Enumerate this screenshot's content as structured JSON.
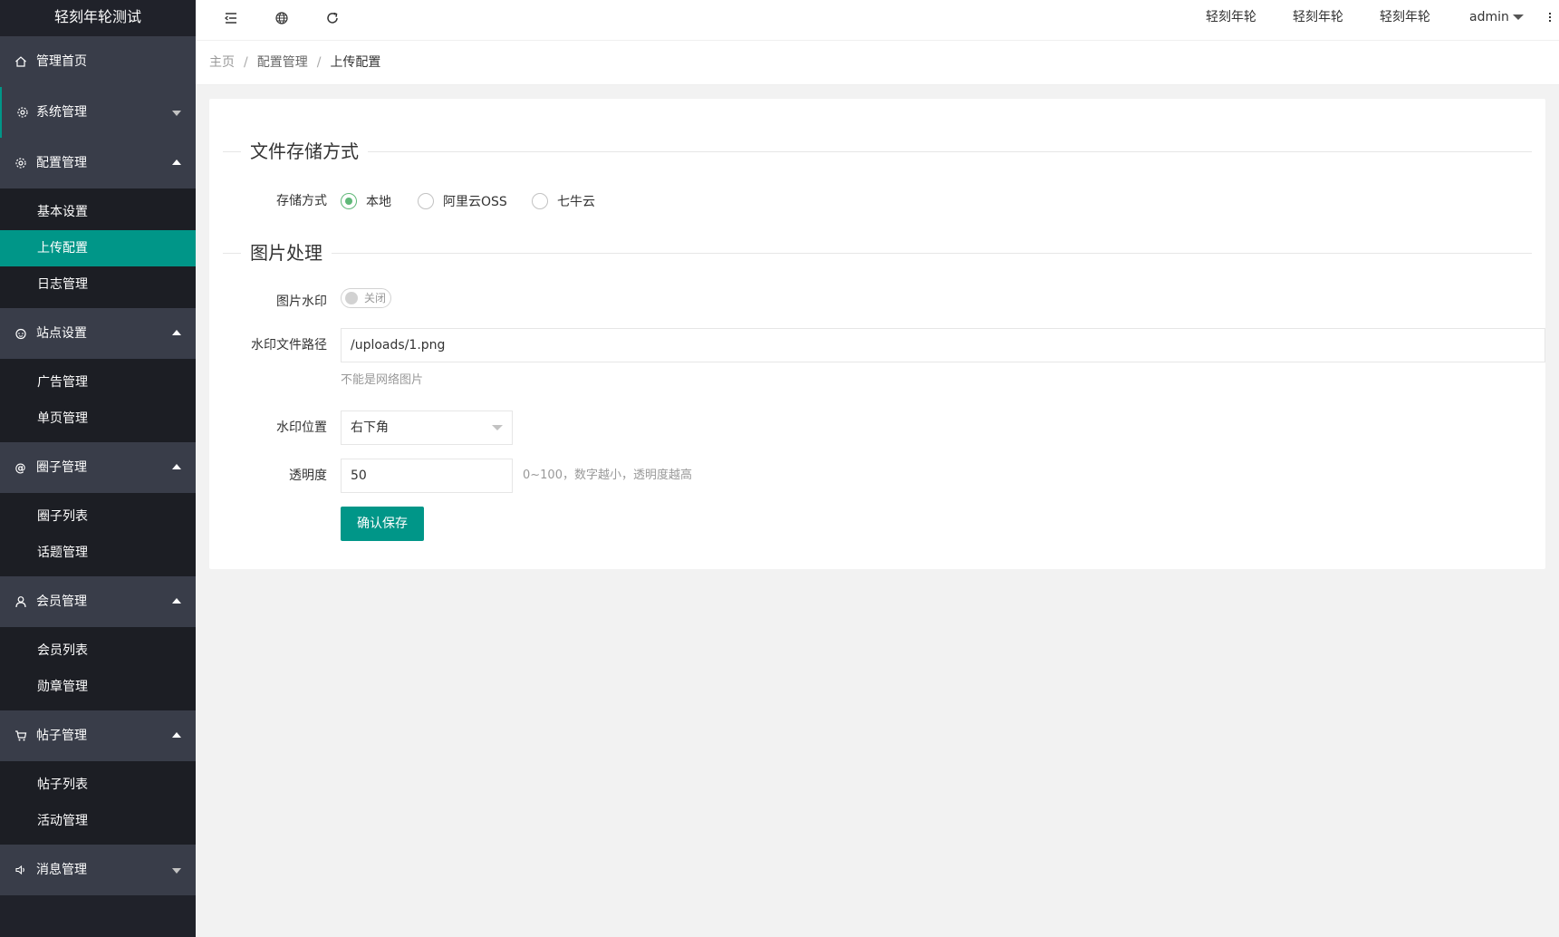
{
  "app": {
    "title": "轻刻年轮测试"
  },
  "sidebar": {
    "items": [
      {
        "label": "管理首页",
        "icon": "home-icon"
      },
      {
        "label": "系统管理",
        "icon": "gear-icon"
      },
      {
        "label": "配置管理",
        "icon": "gear-icon",
        "children": [
          "基本设置",
          "上传配置",
          "日志管理"
        ]
      },
      {
        "label": "站点设置",
        "icon": "face-icon",
        "children": [
          "广告管理",
          "单页管理"
        ]
      },
      {
        "label": "圈子管理",
        "icon": "at-icon",
        "children": [
          "圈子列表",
          "话题管理"
        ]
      },
      {
        "label": "会员管理",
        "icon": "user-icon",
        "children": [
          "会员列表",
          "勋章管理"
        ]
      },
      {
        "label": "帖子管理",
        "icon": "cart-icon",
        "children": [
          "帖子列表",
          "活动管理"
        ]
      },
      {
        "label": "消息管理",
        "icon": "speaker-icon"
      }
    ],
    "active_sub": "上传配置"
  },
  "header": {
    "icons": [
      "menu-shrink-icon",
      "globe-icon",
      "refresh-icon",
      "more-icon"
    ],
    "links": [
      "轻刻年轮",
      "轻刻年轮",
      "轻刻年轮"
    ],
    "user": "admin"
  },
  "breadcrumb": [
    "主页",
    "配置管理",
    "上传配置"
  ],
  "form": {
    "section_storage": "文件存储方式",
    "storage_label": "存储方式",
    "storage_options": [
      "本地",
      "阿里云OSS",
      "七牛云"
    ],
    "storage_selected": "本地",
    "section_image": "图片处理",
    "watermark_label": "图片水印",
    "watermark_switch_text": "关闭",
    "watermark_enabled": false,
    "watermark_path_label": "水印文件路径",
    "watermark_path_value": "/uploads/1.png",
    "watermark_path_hint": "不能是网络图片",
    "position_label": "水印位置",
    "position_value": "右下角",
    "opacity_label": "透明度",
    "opacity_value": "50",
    "opacity_hint": "0~100，数字越小，透明度越高",
    "save_label": "确认保存"
  },
  "colors": {
    "accent": "#009688",
    "sidebar": "#393d49",
    "sidebar_dark": "#20222a",
    "radio_checked": "#5fb878"
  }
}
